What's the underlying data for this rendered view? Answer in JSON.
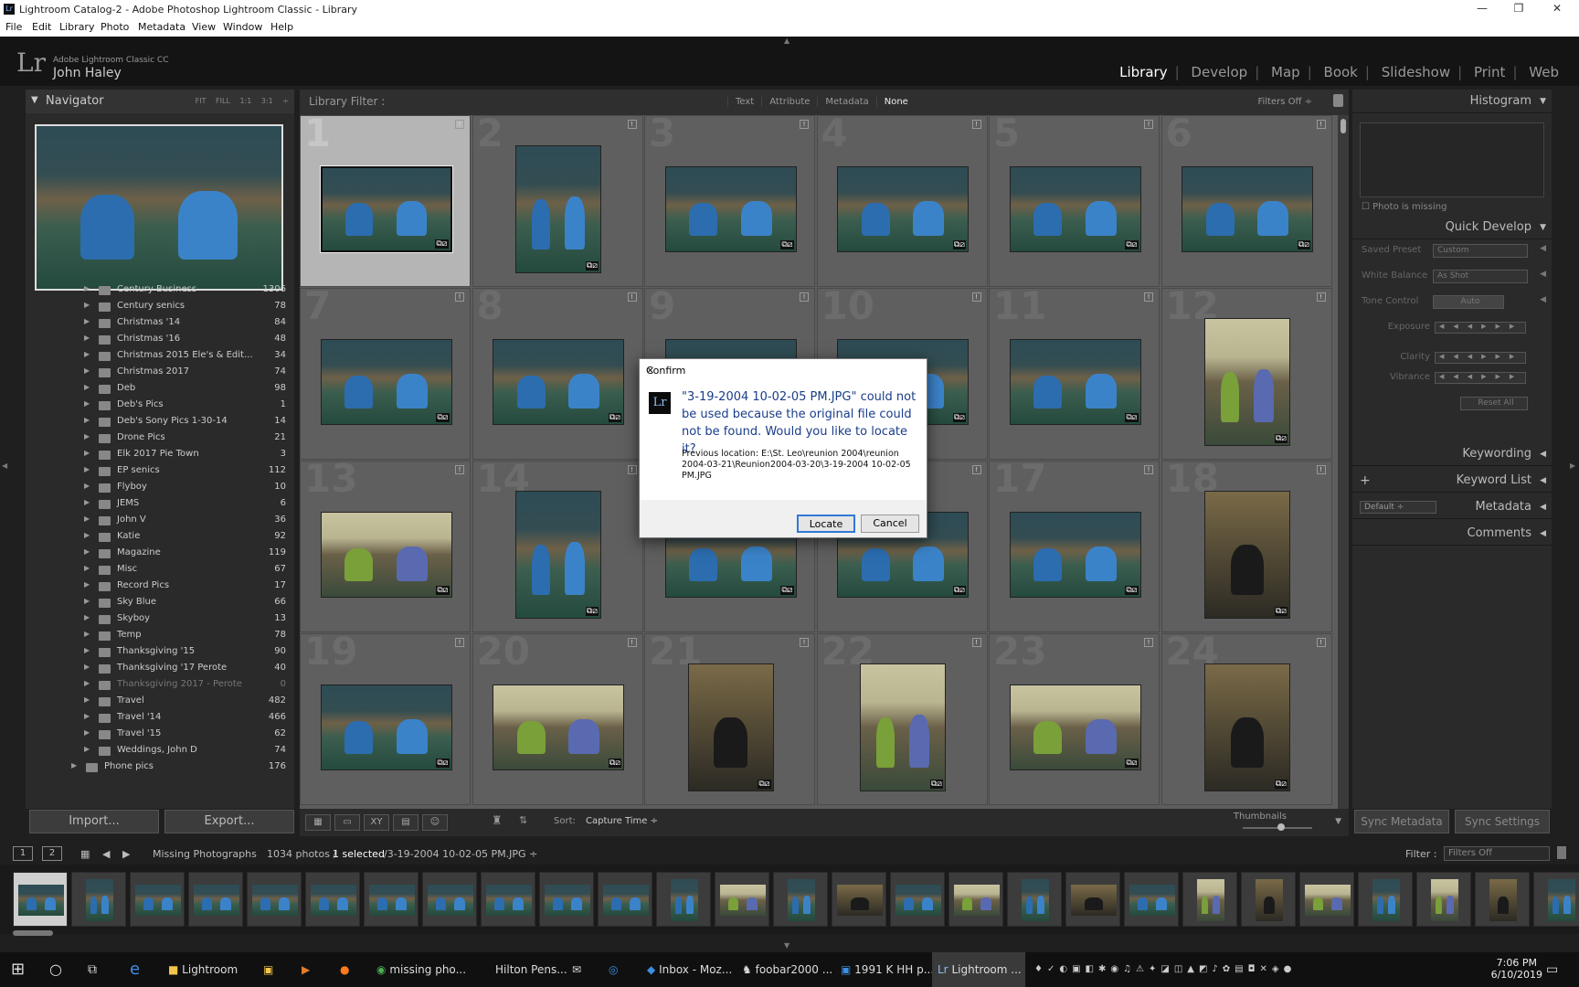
{
  "window": {
    "title": "Lightroom Catalog-2 - Adobe Photoshop Lightroom Classic - Library",
    "app_icon": "Lr"
  },
  "menu": [
    "File",
    "Edit",
    "Library",
    "Photo",
    "Metadata",
    "View",
    "Window",
    "Help"
  ],
  "identity": {
    "logo": "Lr",
    "product": "Adobe Lightroom Classic CC",
    "user": "John Haley"
  },
  "modules": [
    {
      "label": "Library",
      "active": true
    },
    {
      "label": "Develop"
    },
    {
      "label": "Map"
    },
    {
      "label": "Book"
    },
    {
      "label": "Slideshow"
    },
    {
      "label": "Print"
    },
    {
      "label": "Web"
    }
  ],
  "navigator": {
    "title": "Navigator",
    "options": "FIT FILL 1:1 3:1 ÷"
  },
  "folders": [
    {
      "name": "Century Business",
      "count": "1306"
    },
    {
      "name": "Century senics",
      "count": "78"
    },
    {
      "name": "Christmas '14",
      "count": "84"
    },
    {
      "name": "Christmas '16",
      "count": "48"
    },
    {
      "name": "Christmas 2015 Ele's & Edit...",
      "count": "34"
    },
    {
      "name": "Christmas 2017",
      "count": "74"
    },
    {
      "name": "Deb",
      "count": "98"
    },
    {
      "name": "Deb's Pics",
      "count": "1"
    },
    {
      "name": "Deb's Sony Pics 1-30-14",
      "count": "14"
    },
    {
      "name": "Drone Pics",
      "count": "21"
    },
    {
      "name": "Elk 2017 Pie Town",
      "count": "3"
    },
    {
      "name": "EP senics",
      "count": "112"
    },
    {
      "name": "Flyboy",
      "count": "10"
    },
    {
      "name": "JEMS",
      "count": "6"
    },
    {
      "name": "John V",
      "count": "36"
    },
    {
      "name": "Katie",
      "count": "92"
    },
    {
      "name": "Magazine",
      "count": "119"
    },
    {
      "name": "Misc",
      "count": "67"
    },
    {
      "name": "Record Pics",
      "count": "17"
    },
    {
      "name": "Sky Blue",
      "count": "66"
    },
    {
      "name": "Skyboy",
      "count": "13"
    },
    {
      "name": "Temp",
      "count": "78"
    },
    {
      "name": "Thanksgiving '15",
      "count": "90"
    },
    {
      "name": "Thanksgiving '17 Perote",
      "count": "40"
    },
    {
      "name": "Thanksgiving 2017 - Perote",
      "count": "0"
    },
    {
      "name": "Travel",
      "count": "482"
    },
    {
      "name": "Travel '14",
      "count": "466"
    },
    {
      "name": "Travel '15",
      "count": "62"
    },
    {
      "name": "Weddings, John D",
      "count": "74"
    },
    {
      "name": "Phone pics",
      "count": "176"
    }
  ],
  "left_buttons": {
    "import": "Import...",
    "export": "Export..."
  },
  "library_filter": {
    "label": "Library Filter :",
    "options": [
      "Text",
      "Attribute",
      "Metadata",
      "None"
    ],
    "selected": "None",
    "filters_off": "Filters Off ÷"
  },
  "grid_numbers": [
    "1",
    "2",
    "3",
    "4",
    "5",
    "6",
    "7",
    "8",
    "9",
    "10",
    "11",
    "12",
    "13",
    "14",
    "15",
    "16",
    "17",
    "18",
    "19",
    "20",
    "21",
    "22",
    "23",
    "24"
  ],
  "toolbar": {
    "sort_label": "Sort:",
    "sort_value": "Capture Time ÷",
    "thumbnails_label": "Thumbnails"
  },
  "right_panel": {
    "histogram": "Histogram",
    "photo_missing": "Photo is missing",
    "quick_develop": "Quick Develop",
    "saved_preset_label": "Saved Preset",
    "saved_preset_value": "Custom",
    "white_balance_label": "White Balance",
    "white_balance_value": "As Shot",
    "tone_control_label": "Tone Control",
    "tone_control_value": "Auto",
    "exposure": "Exposure",
    "clarity": "Clarity",
    "vibrance": "Vibrance",
    "reset_all": "Reset All",
    "keywording": "Keywording",
    "keyword_list": "Keyword List",
    "metadata": "Metadata",
    "metadata_preset": "Default ÷",
    "comments": "Comments",
    "sync_metadata": "Sync Metadata",
    "sync_settings": "Sync Settings"
  },
  "filmstrip_bar": {
    "screen1": "1",
    "screen2": "2",
    "source": "Missing Photographs",
    "count": "1034 photos /",
    "selected": "1 selected",
    "filename": "/3-19-2004 10-02-05 PM.JPG ÷",
    "filter_label": "Filter :",
    "filter_value": "Filters Off"
  },
  "dialog": {
    "title": "Confirm",
    "icon": "Lr",
    "message": "\"3-19-2004 10-02-05 PM.JPG\" could not be used because the original file could not be found. Would you like to locate it?",
    "previous": "Previous location: E:\\St. Leo\\reunion 2004\\reunion 2004-03-21\\Reunion2004-03-20\\3-19-2004 10-02-05 PM.JPG",
    "locate": "Locate",
    "cancel": "Cancel"
  },
  "taskbar": {
    "items": [
      "Lightroom",
      "missing pho...",
      "Hilton Pens...",
      "Inbox - Moz...",
      "foobar2000 ...",
      "1991 K HH p...",
      "Lightroom ..."
    ],
    "time": "7:06 PM",
    "date": "6/10/2019"
  }
}
